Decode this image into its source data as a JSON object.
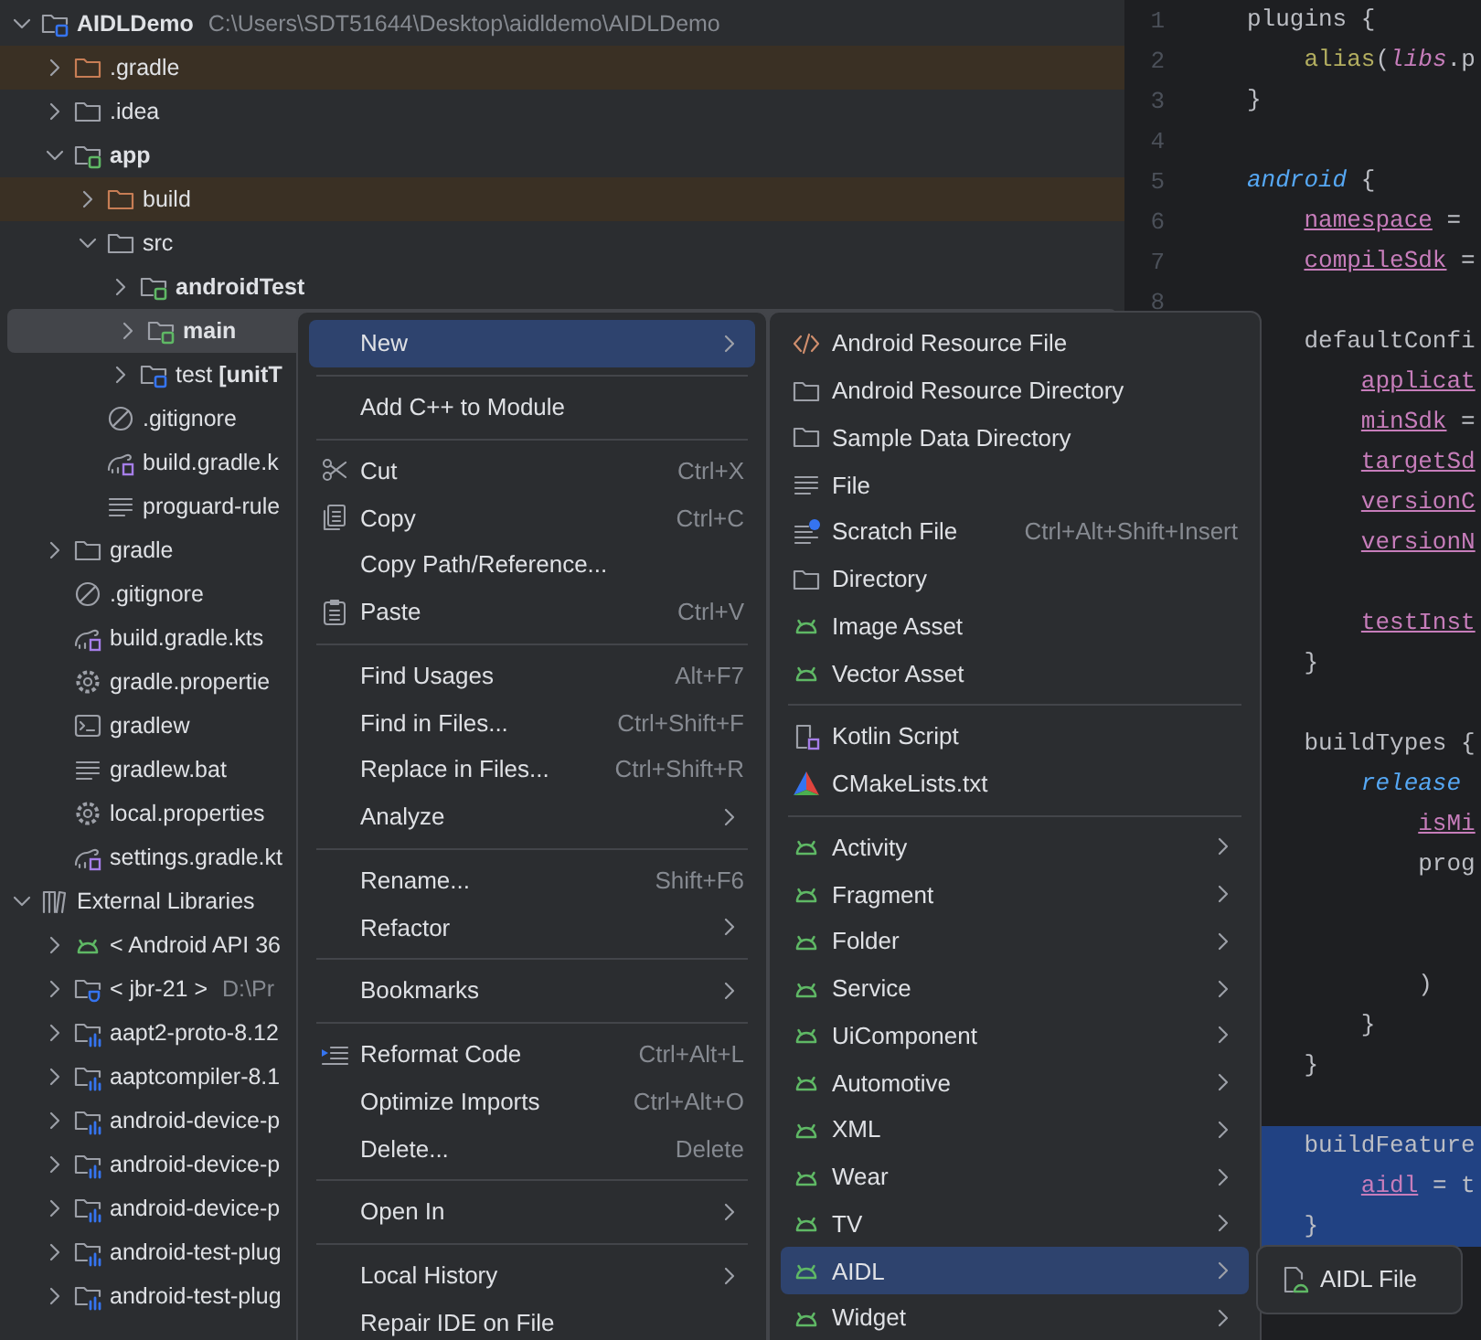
{
  "tree": [
    {
      "label": "AIDLDemo",
      "detail": "C:\\Users\\SDT51644\\Desktop\\aidldemo\\AIDLDemo",
      "kind": "badged-folder",
      "color": "#3574f0",
      "bold": true,
      "expanded": true,
      "selected": false,
      "excluded": false,
      "children": [
        {
          "label": ".gradle",
          "kind": "folder",
          "bold": false,
          "expanded": false,
          "selected": false,
          "excluded": true
        },
        {
          "label": ".idea",
          "kind": "folder",
          "bold": false,
          "expanded": false,
          "selected": false,
          "excluded": false
        },
        {
          "label": "app",
          "kind": "badged-folder",
          "color": "#5fb865",
          "bold": true,
          "expanded": true,
          "selected": false,
          "excluded": false,
          "children": [
            {
              "label": "build",
              "kind": "folder",
              "bold": false,
              "expanded": false,
              "selected": false,
              "excluded": true
            },
            {
              "label": "src",
              "kind": "folder",
              "bold": false,
              "expanded": true,
              "selected": false,
              "excluded": false,
              "children": [
                {
                  "label": "androidTest",
                  "kind": "badged-folder",
                  "color": "#5fb865",
                  "bold": true,
                  "expanded": false,
                  "selected": false,
                  "excluded": false
                },
                {
                  "label": "main",
                  "kind": "badged-folder",
                  "color": "#5fb865",
                  "bold": true,
                  "expanded": false,
                  "selected": true,
                  "excluded": false
                },
                {
                  "label": "test **[unitT**",
                  "kind": "badged-folder",
                  "color": "#3574f0",
                  "bold": false,
                  "expanded": false,
                  "selected": false,
                  "excluded": false
                }
              ]
            },
            {
              "label": ".gitignore",
              "kind": "ignore",
              "bold": false,
              "selected": false,
              "excluded": false
            },
            {
              "label": "build.gradle.k",
              "kind": "gradle-kts",
              "bold": false,
              "selected": false,
              "excluded": false
            },
            {
              "label": "proguard-rule",
              "kind": "lines",
              "bold": false,
              "selected": false,
              "excluded": false
            }
          ]
        },
        {
          "label": "gradle",
          "kind": "folder",
          "bold": false,
          "expanded": false,
          "selected": false,
          "excluded": false
        },
        {
          "label": ".gitignore",
          "kind": "ignore",
          "bold": false,
          "selected": false,
          "excluded": false
        },
        {
          "label": "build.gradle.kts",
          "kind": "gradle-kts",
          "bold": false,
          "selected": false,
          "excluded": false
        },
        {
          "label": "gradle.propertie",
          "kind": "gear",
          "bold": false,
          "selected": false,
          "excluded": false
        },
        {
          "label": "gradlew",
          "kind": "terminal",
          "bold": false,
          "selected": false,
          "excluded": false
        },
        {
          "label": "gradlew.bat",
          "kind": "lines",
          "bold": false,
          "selected": false,
          "excluded": false
        },
        {
          "label": "local.properties",
          "kind": "gear",
          "bold": false,
          "selected": false,
          "excluded": false
        },
        {
          "label": "settings.gradle.kt",
          "kind": "gradle-kts",
          "bold": false,
          "selected": false,
          "excluded": false
        }
      ]
    },
    {
      "label": "External Libraries",
      "kind": "library",
      "bold": false,
      "expanded": true,
      "selected": false,
      "excluded": false,
      "children": [
        {
          "label": "< Android API 36",
          "kind": "android",
          "bold": false,
          "expanded": false,
          "selected": false,
          "excluded": false
        },
        {
          "label": "< jbr-21 >",
          "detail": "D:\\Pr",
          "kind": "jdk",
          "bold": false,
          "expanded": false,
          "selected": false,
          "excluded": false
        },
        {
          "label": "aapt2-proto-8.12",
          "kind": "lib-folder",
          "bold": false,
          "expanded": false,
          "selected": false,
          "excluded": false
        },
        {
          "label": "aaptcompiler-8.1",
          "kind": "lib-folder",
          "bold": false,
          "expanded": false,
          "selected": false,
          "excluded": false
        },
        {
          "label": "android-device-p",
          "kind": "lib-folder",
          "bold": false,
          "expanded": false,
          "selected": false,
          "excluded": false
        },
        {
          "label": "android-device-p",
          "kind": "lib-folder",
          "bold": false,
          "expanded": false,
          "selected": false,
          "excluded": false
        },
        {
          "label": "android-device-p",
          "kind": "lib-folder",
          "bold": false,
          "expanded": false,
          "selected": false,
          "excluded": false
        },
        {
          "label": "android-test-plug",
          "kind": "lib-folder",
          "bold": false,
          "expanded": false,
          "selected": false,
          "excluded": false
        },
        {
          "label": "android-test-plug",
          "kind": "lib-folder",
          "bold": false,
          "expanded": false,
          "selected": false,
          "excluded": false
        }
      ]
    }
  ],
  "editor": {
    "lines": [
      {
        "kind": "code",
        "number": "1",
        "selected": false,
        "tokens": [
          {
            "kind": "plain",
            "text": "plugins {"
          }
        ]
      },
      {
        "kind": "code",
        "number": "2",
        "selected": false,
        "tokens": [
          {
            "kind": "call",
            "text": "    alias"
          },
          {
            "kind": "plain",
            "text": "("
          },
          {
            "kind": "receiver",
            "text": "libs"
          },
          {
            "kind": "plain",
            "text": ".p"
          }
        ]
      },
      {
        "kind": "code",
        "number": "3",
        "selected": false,
        "tokens": [
          {
            "kind": "plain",
            "text": "}"
          }
        ]
      },
      {
        "kind": "blank",
        "number": "4"
      },
      {
        "kind": "code",
        "number": "5",
        "selected": false,
        "tokens": [
          {
            "kind": "block",
            "text": "android"
          },
          {
            "kind": "plain",
            "text": " {"
          }
        ]
      },
      {
        "kind": "code",
        "number": "6",
        "selected": false,
        "tokens": [
          {
            "kind": "property",
            "text": "    namespace"
          },
          {
            "kind": "plain",
            "text": " ="
          }
        ]
      },
      {
        "kind": "code",
        "number": "7",
        "selected": false,
        "tokens": [
          {
            "kind": "property",
            "text": "    compileSdk"
          },
          {
            "kind": "plain",
            "text": " ="
          }
        ]
      },
      {
        "kind": "blank",
        "number": "8"
      },
      {
        "kind": "code",
        "selected": false,
        "tokens": [
          {
            "kind": "plain",
            "text": "    defaultConfi"
          }
        ]
      },
      {
        "kind": "code",
        "selected": false,
        "tokens": [
          {
            "kind": "property",
            "text": "        applicat"
          }
        ]
      },
      {
        "kind": "code",
        "selected": false,
        "tokens": [
          {
            "kind": "property",
            "text": "        minSdk"
          },
          {
            "kind": "plain",
            "text": " ="
          }
        ]
      },
      {
        "kind": "code",
        "selected": false,
        "tokens": [
          {
            "kind": "property",
            "text": "        targetSd"
          }
        ]
      },
      {
        "kind": "code",
        "selected": false,
        "tokens": [
          {
            "kind": "property",
            "text": "        versionC"
          }
        ]
      },
      {
        "kind": "code",
        "selected": false,
        "tokens": [
          {
            "kind": "property",
            "text": "        versionN"
          }
        ]
      },
      {
        "kind": "blank"
      },
      {
        "kind": "code",
        "selected": false,
        "tokens": [
          {
            "kind": "property",
            "text": "        testInst"
          }
        ]
      },
      {
        "kind": "code",
        "selected": false,
        "tokens": [
          {
            "kind": "plain",
            "text": "    }"
          }
        ]
      },
      {
        "kind": "blank"
      },
      {
        "kind": "code",
        "selected": false,
        "tokens": [
          {
            "kind": "plain",
            "text": "    buildTypes {"
          }
        ]
      },
      {
        "kind": "code",
        "selected": false,
        "tokens": [
          {
            "kind": "block",
            "text": "        release"
          }
        ]
      },
      {
        "kind": "code",
        "selected": false,
        "tokens": [
          {
            "kind": "property",
            "text": "            isMi"
          }
        ]
      },
      {
        "kind": "code",
        "selected": false,
        "tokens": [
          {
            "kind": "plain",
            "text": "            prog"
          }
        ]
      },
      {
        "kind": "blank"
      },
      {
        "kind": "blank"
      },
      {
        "kind": "code",
        "selected": false,
        "tokens": [
          {
            "kind": "plain",
            "text": "            )"
          }
        ]
      },
      {
        "kind": "code",
        "selected": false,
        "tokens": [
          {
            "kind": "plain",
            "text": "        }"
          }
        ]
      },
      {
        "kind": "code",
        "selected": false,
        "tokens": [
          {
            "kind": "plain",
            "text": "    }"
          }
        ]
      },
      {
        "kind": "blank"
      },
      {
        "kind": "code",
        "selected": true,
        "tokens": [
          {
            "kind": "plain",
            "text": "    buildFeature"
          }
        ]
      },
      {
        "kind": "code",
        "selected": true,
        "tokens": [
          {
            "kind": "property",
            "text": "        aidl"
          },
          {
            "kind": "plain",
            "text": " = t"
          }
        ]
      },
      {
        "kind": "code",
        "selected": true,
        "tokens": [
          {
            "kind": "plain",
            "text": "    }"
          }
        ]
      }
    ]
  },
  "context_menu": {
    "items": [
      {
        "kind": "plain",
        "label": "New",
        "submenu": true,
        "selected": true
      },
      {
        "kind": "separator"
      },
      {
        "kind": "plain",
        "label": "Add C++ to Module",
        "submenu": false,
        "selected": false
      },
      {
        "kind": "separator"
      },
      {
        "kind": "scissors",
        "label": "Cut",
        "shortcut": "Ctrl+X",
        "submenu": false,
        "selected": false
      },
      {
        "kind": "copy",
        "label": "Copy",
        "shortcut": "Ctrl+C",
        "submenu": false,
        "selected": false
      },
      {
        "kind": "plain",
        "label": "Copy Path/Reference...",
        "submenu": false,
        "selected": false
      },
      {
        "kind": "paste",
        "label": "Paste",
        "shortcut": "Ctrl+V",
        "submenu": false,
        "selected": false
      },
      {
        "kind": "separator"
      },
      {
        "kind": "plain",
        "label": "Find Usages",
        "shortcut": "Alt+F7",
        "submenu": false,
        "selected": false
      },
      {
        "kind": "plain",
        "label": "Find in Files...",
        "shortcut": "Ctrl+Shift+F",
        "submenu": false,
        "selected": false
      },
      {
        "kind": "plain",
        "label": "Replace in Files...",
        "shortcut": "Ctrl+Shift+R",
        "submenu": false,
        "selected": false
      },
      {
        "kind": "plain",
        "label": "Analyze",
        "submenu": true,
        "selected": false
      },
      {
        "kind": "separator"
      },
      {
        "kind": "plain",
        "label": "Rename...",
        "shortcut": "Shift+F6",
        "submenu": false,
        "selected": false
      },
      {
        "kind": "plain",
        "label": "Refactor",
        "submenu": true,
        "selected": false
      },
      {
        "kind": "separator"
      },
      {
        "kind": "plain",
        "label": "Bookmarks",
        "submenu": true,
        "selected": false
      },
      {
        "kind": "separator"
      },
      {
        "kind": "reformat",
        "label": "Reformat Code",
        "shortcut": "Ctrl+Alt+L",
        "submenu": false,
        "selected": false
      },
      {
        "kind": "plain",
        "label": "Optimize Imports",
        "shortcut": "Ctrl+Alt+O",
        "submenu": false,
        "selected": false
      },
      {
        "kind": "plain",
        "label": "Delete...",
        "shortcut": "Delete",
        "submenu": false,
        "selected": false
      },
      {
        "kind": "separator"
      },
      {
        "kind": "plain",
        "label": "Open In",
        "submenu": true,
        "selected": false
      },
      {
        "kind": "separator"
      },
      {
        "kind": "plain",
        "label": "Local History",
        "submenu": true,
        "selected": false
      },
      {
        "kind": "plain",
        "label": "Repair IDE on File",
        "submenu": false,
        "selected": false
      }
    ]
  },
  "new_submenu": {
    "items": [
      {
        "kind": "code",
        "label": "Android Resource File",
        "submenu": false,
        "selected": false
      },
      {
        "kind": "folder",
        "label": "Android Resource Directory",
        "submenu": false,
        "selected": false
      },
      {
        "kind": "folder",
        "label": "Sample Data Directory",
        "submenu": false,
        "selected": false
      },
      {
        "kind": "lines",
        "label": "File",
        "submenu": false,
        "selected": false
      },
      {
        "kind": "scratch",
        "label": "Scratch File",
        "shortcut": "Ctrl+Alt+Shift+Insert",
        "submenu": false,
        "selected": false
      },
      {
        "kind": "folder",
        "label": "Directory",
        "submenu": false,
        "selected": false
      },
      {
        "kind": "android",
        "label": "Image Asset",
        "submenu": false,
        "selected": false
      },
      {
        "kind": "android",
        "label": "Vector Asset",
        "submenu": false,
        "selected": false
      },
      {
        "kind": "separator"
      },
      {
        "kind": "kotlin-script",
        "label": "Kotlin Script",
        "submenu": false,
        "selected": false
      },
      {
        "kind": "cmake",
        "label": "CMakeLists.txt",
        "submenu": false,
        "selected": false
      },
      {
        "kind": "separator"
      },
      {
        "kind": "android",
        "label": "Activity",
        "submenu": true,
        "selected": false
      },
      {
        "kind": "android",
        "label": "Fragment",
        "submenu": true,
        "selected": false
      },
      {
        "kind": "android",
        "label": "Folder",
        "submenu": true,
        "selected": false
      },
      {
        "kind": "android",
        "label": "Service",
        "submenu": true,
        "selected": false
      },
      {
        "kind": "android",
        "label": "UiComponent",
        "submenu": true,
        "selected": false
      },
      {
        "kind": "android",
        "label": "Automotive",
        "submenu": true,
        "selected": false
      },
      {
        "kind": "android",
        "label": "XML",
        "submenu": true,
        "selected": false
      },
      {
        "kind": "android",
        "label": "Wear",
        "submenu": true,
        "selected": false
      },
      {
        "kind": "android",
        "label": "TV",
        "submenu": true,
        "selected": false
      },
      {
        "kind": "android",
        "label": "AIDL",
        "submenu": true,
        "selected": true
      },
      {
        "kind": "android",
        "label": "Widget",
        "submenu": true,
        "selected": false
      }
    ]
  },
  "aidl_submenu": {
    "items": [
      {
        "kind": "aidl-file",
        "label": "AIDL File",
        "submenu": false,
        "selected": false
      }
    ]
  }
}
